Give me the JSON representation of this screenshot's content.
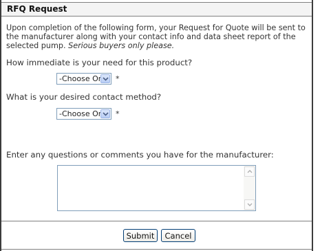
{
  "header": {
    "title": "RFQ Request"
  },
  "intro": {
    "text": "Upon completion of the following form, your Request for Quote will be sent to the manufacturer along with your contact info and data sheet report of the selected pump.",
    "emphasis": "Serious buyers only please."
  },
  "questions": {
    "need": {
      "label": "How immediate is your need for this product?",
      "selected": "-Choose One-",
      "required_mark": "*"
    },
    "contact": {
      "label": "What is your desired contact method?",
      "selected": "-Choose One-",
      "required_mark": "*"
    },
    "comments": {
      "label": "Enter any questions or comments you have for the manufacturer:",
      "value": ""
    }
  },
  "actions": {
    "submit_label": "Submit",
    "cancel_label": "Cancel"
  },
  "colors": {
    "field_border": "#7f9db9",
    "button_border": "#003c74",
    "frame_border": "#3c3c3c"
  }
}
